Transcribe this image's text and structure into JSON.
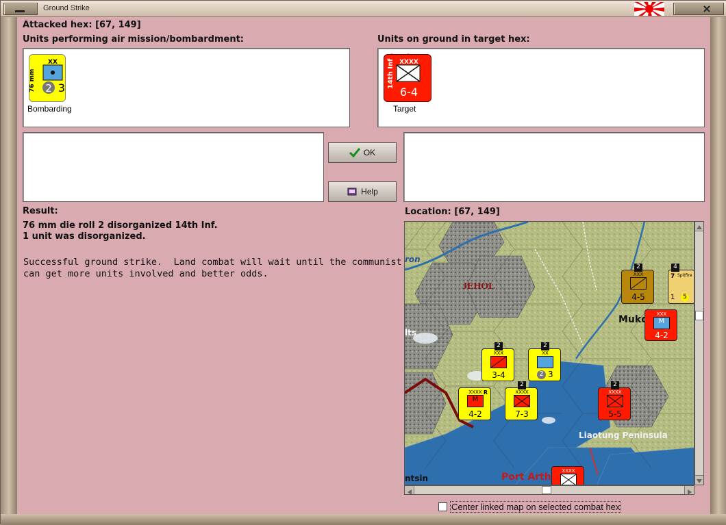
{
  "window": {
    "title": "Ground Strike"
  },
  "header": {
    "attacked_hex": "Attacked hex:  [67, 149]"
  },
  "air_panel": {
    "label": "Units performing air mission/bombardment:",
    "unit": {
      "size": "XX",
      "name": "76 mm",
      "strength_left": "2",
      "strength_right": "3",
      "caption": "Bombarding",
      "color": "#ffff00"
    }
  },
  "ground_panel": {
    "label": "Units on ground in target hex:",
    "unit": {
      "size": "XXXX",
      "name": "14th Inf",
      "strength": "6-4",
      "caption": "Target",
      "color": "#ff0000"
    }
  },
  "buttons": {
    "ok": "OK",
    "help": "Help"
  },
  "result": {
    "label": "Result:",
    "line1": "76 mm die roll 2 disorganized 14th Inf.",
    "line2": "1 unit was disorganized.",
    "message_line1": "Successful ground strike.  Land combat will wait until the communist",
    "message_line2": "can get more units involved and better odds."
  },
  "location": {
    "label": "Location:  [67, 149]"
  },
  "map": {
    "labels": {
      "jehol": "JEHOL",
      "mukden": "Mukd",
      "liaotung": "Liaotung Peninsula",
      "port_arthur": "Port Arth",
      "left_a": "lts",
      "left_b": "ntsin",
      "left_c": "ron"
    },
    "counters": [
      {
        "size": "XXX",
        "strength": "4-5",
        "stack": "2",
        "color": "#b8860b"
      },
      {
        "size": "7",
        "name": "Spitfire",
        "strength": "1",
        "extra": "5",
        "stack": "4",
        "color": "#f0d070"
      },
      {
        "size": "XXX",
        "strength": "4-2",
        "color": "#ff0000"
      },
      {
        "size": "XXX",
        "strength": "3-4",
        "stack": "2",
        "color": "#ffff00"
      },
      {
        "size": "XX",
        "strength": "3",
        "strength_left": "2",
        "stack": "2",
        "color": "#ffff00"
      },
      {
        "size": "XXXX",
        "strength": "4-2",
        "marker": "R",
        "color": "#ffff00"
      },
      {
        "size": "XXXX",
        "strength": "7-3",
        "stack": "2",
        "color": "#ffff00"
      },
      {
        "size": "XXXX",
        "strength": "5-5",
        "stack": "2",
        "color": "#ff0000"
      },
      {
        "size": "XXXX",
        "strength": "",
        "color": "#ff0000"
      }
    ]
  },
  "footer": {
    "center_linked_label": "Center linked map on selected combat hex"
  }
}
